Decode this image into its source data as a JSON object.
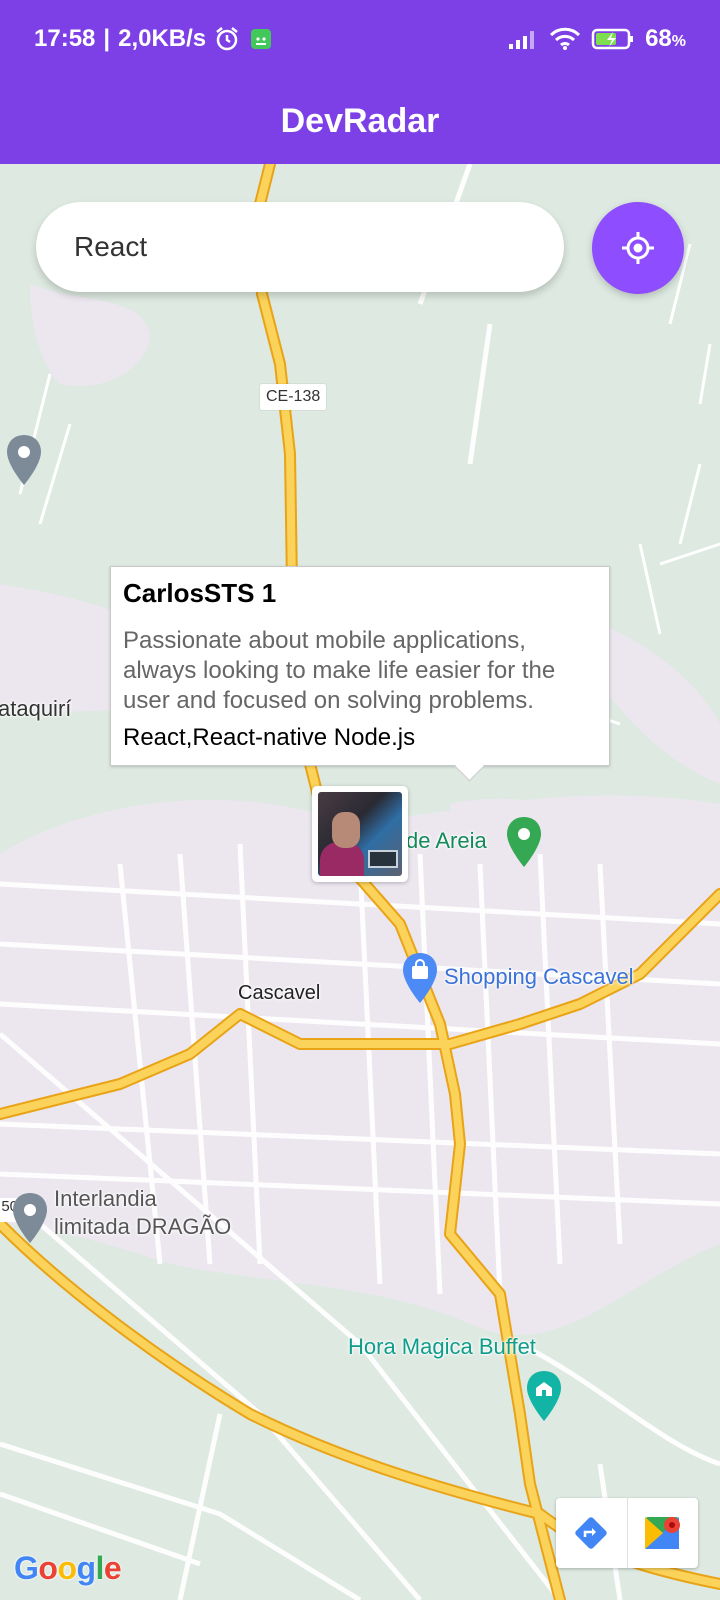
{
  "status_bar": {
    "time": "17:58",
    "network_speed": "2,0KB/s",
    "battery": "68",
    "battery_unit": "%"
  },
  "app": {
    "title": "DevRadar"
  },
  "search": {
    "value": "React"
  },
  "callout": {
    "name": "CarlosSTS 1",
    "bio": "Passionate about mobile applications, always looking to make life easier for the user and focused on solving problems.",
    "techs": "React,React-native Node.js"
  },
  "map": {
    "road_shield": "CE-138",
    "left_shield": "50",
    "labels": {
      "taquiri": "ataquirí",
      "de_areia": "de Areia",
      "shopping": "Shopping Cascavel",
      "cascavel": "Cascavel",
      "interlandia_line1": "Interlandia",
      "interlandia_line2": "limitada DRAGÃO",
      "hora_magica": "Hora Magica Buffet"
    },
    "google_logo": {
      "G": "G",
      "o1": "o",
      "o2": "o",
      "g": "g",
      "l": "l",
      "e": "e"
    }
  },
  "colors": {
    "app_bar": "#7d40e7",
    "locate_button": "#8e4dff",
    "map_green": "#dde9e1",
    "map_urban": "#ece7ef",
    "major_road": "#f9c953",
    "poi_teal": "#0f9d8a",
    "poi_blue": "#4285f4"
  },
  "icons": {
    "locate": "my-location-icon",
    "directions": "directions-icon",
    "maps": "google-maps-icon"
  }
}
